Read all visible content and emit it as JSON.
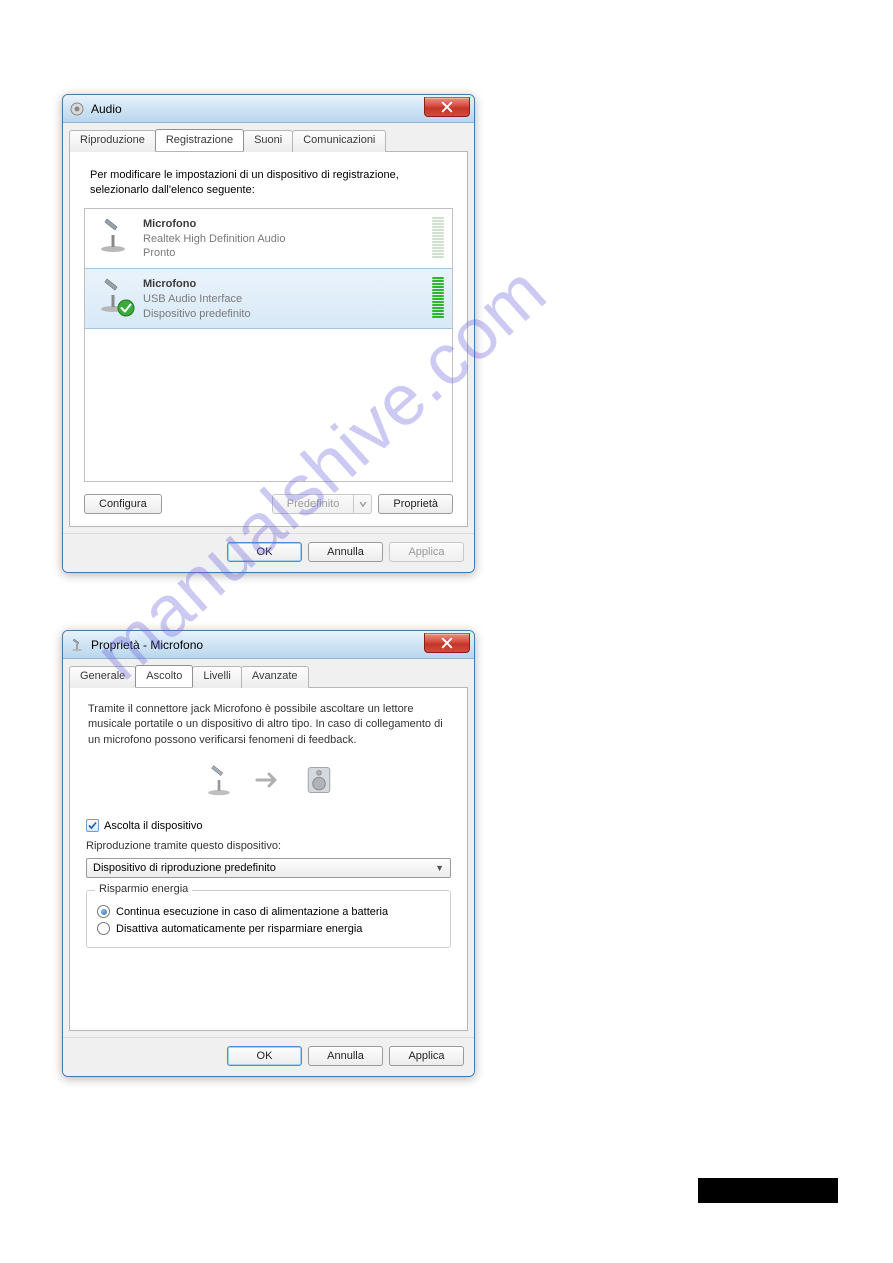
{
  "watermark": "manualshive.com",
  "audio": {
    "title": "Audio",
    "tabs": [
      "Riproduzione",
      "Registrazione",
      "Suoni",
      "Comunicazioni"
    ],
    "active_tab": 1,
    "instructions": "Per modificare le impostazioni di un dispositivo di registrazione, selezionarlo dall'elenco seguente:",
    "devices": [
      {
        "name": "Microfono",
        "detail": "Realtek High Definition Audio",
        "status": "Pronto",
        "selected": false,
        "default": false,
        "level_bars_active": 0,
        "level_bars_total": 14
      },
      {
        "name": "Microfono",
        "detail": "USB Audio Interface",
        "status": "Dispositivo predefinito",
        "selected": true,
        "default": true,
        "level_bars_active": 14,
        "level_bars_total": 14
      }
    ],
    "buttons": {
      "configure": "Configura",
      "set_default": "Predefinito",
      "properties": "Proprietà",
      "ok": "OK",
      "cancel": "Annulla",
      "apply": "Applica"
    }
  },
  "properties": {
    "title": "Proprietà - Microfono",
    "tabs": [
      "Generale",
      "Ascolto",
      "Livelli",
      "Avanzate"
    ],
    "active_tab": 1,
    "body_text": "Tramite il connettore jack Microfono è possibile ascoltare un lettore musicale portatile o un dispositivo di altro tipo. In caso di collegamento di un microfono possono verificarsi fenomeni di feedback.",
    "listen_checkbox_label": "Ascolta il dispositivo",
    "listen_checked": true,
    "playback_label": "Riproduzione tramite questo dispositivo:",
    "playback_selected": "Dispositivo di riproduzione predefinito",
    "power_group": "Risparmio energia",
    "power_options": [
      {
        "label": "Continua esecuzione in caso di alimentazione a batteria",
        "checked": true
      },
      {
        "label": "Disattiva automaticamente per risparmiare energia",
        "checked": false
      }
    ],
    "buttons": {
      "ok": "OK",
      "cancel": "Annulla",
      "apply": "Applica"
    }
  }
}
